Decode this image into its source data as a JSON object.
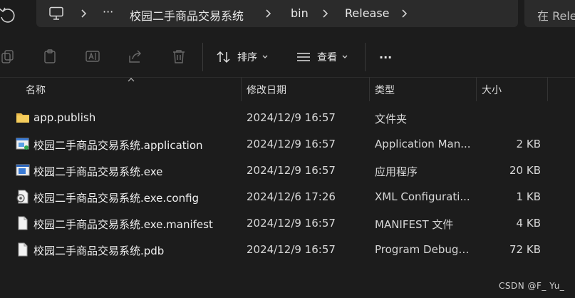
{
  "address": {
    "crumbs": [
      "校园二手商品交易系统",
      "bin",
      "Release"
    ],
    "more": "···",
    "search_placeholder": "在 Rele"
  },
  "toolbar": {
    "sort_label": "排序",
    "view_label": "查看",
    "more_label": "···"
  },
  "columns": {
    "name": "名称",
    "date": "修改日期",
    "type": "类型",
    "size": "大小"
  },
  "files": [
    {
      "icon": "folder-icon",
      "name": "app.publish",
      "date": "2024/12/9 16:57",
      "type": "文件夹",
      "size": ""
    },
    {
      "icon": "application-manifest-icon",
      "name": "校园二手商品交易系统.application",
      "date": "2024/12/9 16:57",
      "type": "Application Man...",
      "size": "2 KB"
    },
    {
      "icon": "exe-icon",
      "name": "校园二手商品交易系统.exe",
      "date": "2024/12/9 16:57",
      "type": "应用程序",
      "size": "20 KB"
    },
    {
      "icon": "config-file-icon",
      "name": "校园二手商品交易系统.exe.config",
      "date": "2024/12/6 17:26",
      "type": "XML Configurati...",
      "size": "1 KB"
    },
    {
      "icon": "file-icon",
      "name": "校园二手商品交易系统.exe.manifest",
      "date": "2024/12/9 16:57",
      "type": "MANIFEST 文件",
      "size": "4 KB"
    },
    {
      "icon": "file-icon",
      "name": "校园二手商品交易系统.pdb",
      "date": "2024/12/9 16:57",
      "type": "Program Debug ...",
      "size": "72 KB"
    }
  ],
  "watermark": "CSDN @F_ Yu_",
  "colors": {
    "background": "#1c1c1c",
    "address_bg": "#2b2b2b",
    "folder": "#f2c14e",
    "exe_accent": "#3a7bd5"
  }
}
